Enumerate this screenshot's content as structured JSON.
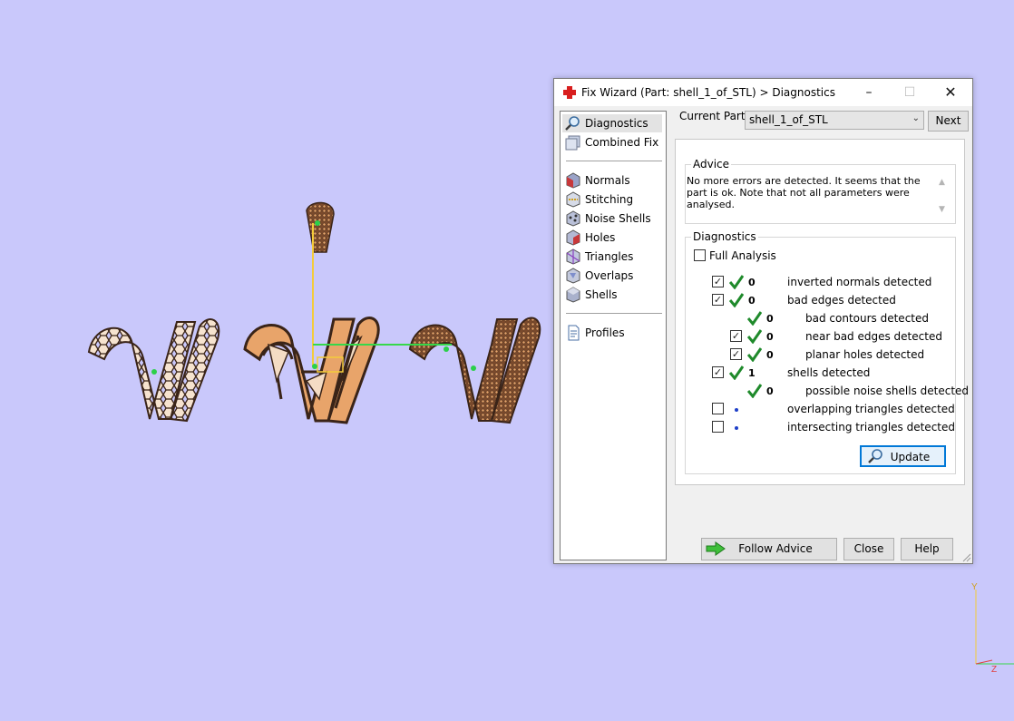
{
  "dialog": {
    "title": "Fix Wizard (Part: shell_1_of_STL) > Diagnostics",
    "window_controls": {
      "minimize": "–",
      "maximize": "☐",
      "close": "✕"
    }
  },
  "nav": {
    "items": [
      {
        "label": "Diagnostics",
        "icon": "magnifier-icon",
        "selected": true
      },
      {
        "label": "Combined Fix",
        "icon": "combined-fix-icon"
      },
      {
        "label": "Normals",
        "icon": "normals-cube-icon"
      },
      {
        "label": "Stitching",
        "icon": "stitching-icon"
      },
      {
        "label": "Noise Shells",
        "icon": "noise-shells-icon"
      },
      {
        "label": "Holes",
        "icon": "holes-cube-icon"
      },
      {
        "label": "Triangles",
        "icon": "triangles-cube-icon"
      },
      {
        "label": "Overlaps",
        "icon": "overlaps-cube-icon"
      },
      {
        "label": "Shells",
        "icon": "shells-cube-icon"
      },
      {
        "label": "Profiles",
        "icon": "document-icon"
      }
    ]
  },
  "part": {
    "label": "Current Part:",
    "value": "shell_1_of_STL",
    "next_label": "Next"
  },
  "advice": {
    "title": "Advice",
    "text": "No more errors are detected. It seems that the part is ok. Note that not all parameters were analysed."
  },
  "diagnostics": {
    "title": "Diagnostics",
    "full_analysis_label": "Full Analysis",
    "full_analysis_checked": false,
    "rows": [
      {
        "label": "inverted normals detected",
        "count": "0",
        "checked": true,
        "status": "ok"
      },
      {
        "label": "bad edges detected",
        "count": "0",
        "checked": true,
        "status": "ok"
      },
      {
        "label": "bad contours detected",
        "count": "0",
        "status": "ok"
      },
      {
        "label": "near bad edges detected",
        "count": "0",
        "checked": true,
        "status": "ok"
      },
      {
        "label": "planar holes detected",
        "count": "0",
        "checked": true,
        "status": "ok"
      },
      {
        "label": "shells detected",
        "count": "1",
        "checked": true,
        "status": "ok"
      },
      {
        "label": "possible noise shells detected",
        "count": "0",
        "status": "ok"
      },
      {
        "label": "overlapping triangles detected",
        "checked": false,
        "status": "not-analysed"
      },
      {
        "label": "intersecting triangles detected",
        "checked": false,
        "status": "not-analysed"
      }
    ],
    "update_label": "Update"
  },
  "buttons": {
    "follow_advice": "Follow Advice",
    "close": "Close",
    "help": "Help"
  },
  "axes": {
    "y": "Y",
    "z": "Z"
  },
  "colors": {
    "viewport_bg": "#c9c8fb",
    "model_fill": "#e8a46a",
    "model_outline": "#3a2418",
    "status_ok": "#1f8a2b",
    "accent": "#0078d7"
  }
}
